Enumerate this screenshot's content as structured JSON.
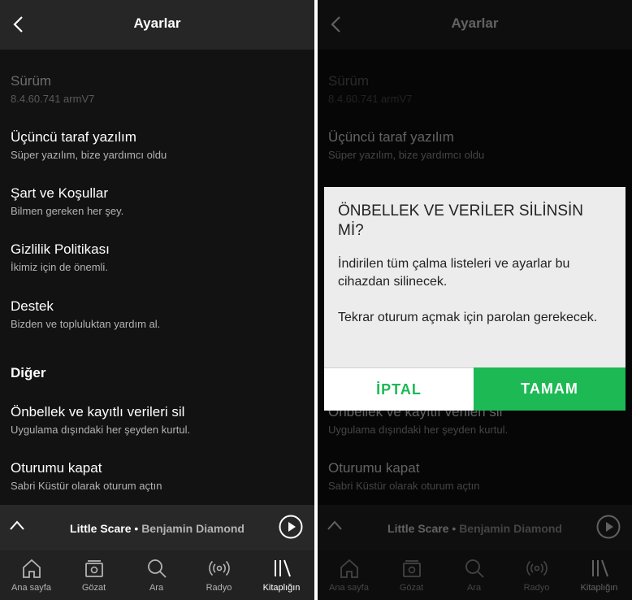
{
  "header": {
    "title": "Ayarlar"
  },
  "settings": {
    "version": {
      "title": "Sürüm",
      "sub": "8.4.60.741 armV7"
    },
    "third_party": {
      "title": "Üçüncü taraf yazılım",
      "sub": "Süper yazılım, bize yardımcı oldu"
    },
    "terms": {
      "title": "Şart ve Koşullar",
      "sub": "Bilmen gereken her şey."
    },
    "privacy": {
      "title": "Gizlilik Politikası",
      "sub": "İkimiz için de önemli."
    },
    "support": {
      "title": "Destek",
      "sub": "Bizden ve topluluktan yardım al."
    },
    "section_other": "Diğer",
    "clear_cache": {
      "title": "Önbellek ve kayıtlı verileri sil",
      "sub": "Uygulama dışındaki her şeyden kurtul."
    },
    "logout": {
      "title": "Oturumu kapat",
      "sub": "Sabri Küstür olarak oturum açtın"
    }
  },
  "now_playing": {
    "song": "Little Scare",
    "separator": " • ",
    "artist": "Benjamin Diamond"
  },
  "tabs": [
    {
      "label": "Ana sayfa",
      "icon": "home-icon"
    },
    {
      "label": "Gözat",
      "icon": "browse-icon"
    },
    {
      "label": "Ara",
      "icon": "search-icon"
    },
    {
      "label": "Radyo",
      "icon": "radio-icon"
    },
    {
      "label": "Kitaplığın",
      "icon": "library-icon"
    }
  ],
  "active_tab": "Kitaplığın",
  "dialog": {
    "title": "ÖNBELLEK VE VERİLER SİLİNSİN Mİ?",
    "body1": "İndirilen tüm çalma listeleri ve ayarlar bu cihazdan silinecek.",
    "body2": "Tekrar oturum açmak için parolan gerekecek.",
    "cancel": "İPTAL",
    "ok": "TAMAM"
  },
  "colors": {
    "accent": "#1db954",
    "background": "#121212",
    "header": "#262626",
    "dialog": "#ececec"
  }
}
